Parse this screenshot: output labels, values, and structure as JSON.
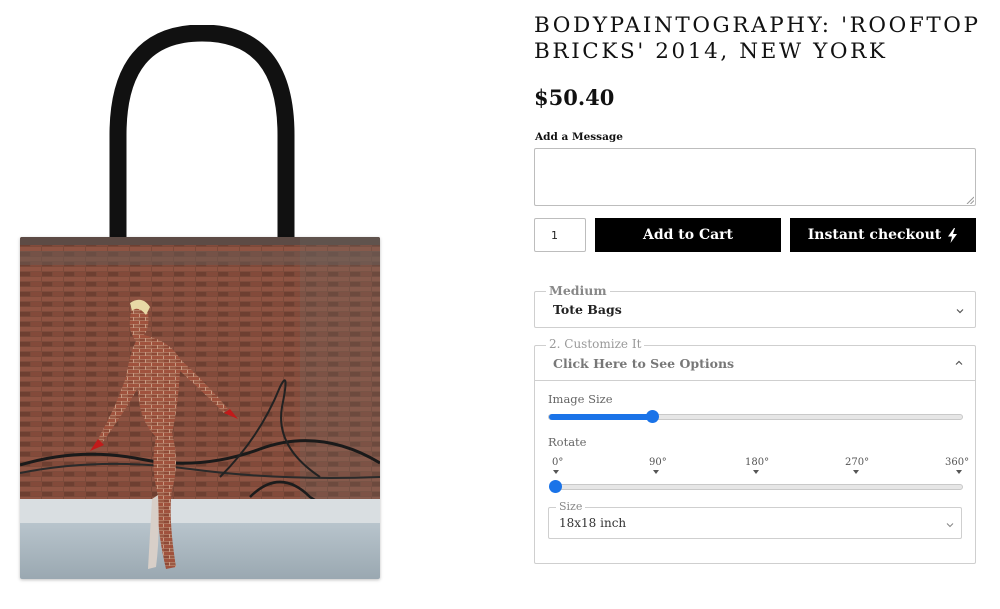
{
  "product": {
    "title_line1": "BODYPAINTOGRAPHY: 'ROOFTOP",
    "title_line2": "BRICKS' 2014, NEW YORK",
    "price": "$50.40"
  },
  "message": {
    "label": "Add a Message",
    "value": ""
  },
  "cart": {
    "quantity": "1",
    "add_to_cart_label": "Add to Cart",
    "instant_checkout_label": "Instant checkout"
  },
  "medium": {
    "legend": "Medium",
    "selected": "Tote Bags"
  },
  "customize": {
    "legend": "2. Customize It",
    "header": "Click Here to See Options",
    "image_size_label": "Image Size",
    "image_size_level": 0.25,
    "rotate_label": "Rotate",
    "rotate_ticks": [
      "0°",
      "90°",
      "180°",
      "270°",
      "360°"
    ],
    "rotate_value": "0°",
    "size_legend": "Size",
    "size_selected": "18x18 inch"
  },
  "colors": {
    "button_bg": "#000000",
    "slider_accent": "#1a73e8",
    "bag_handle": "#111111"
  }
}
